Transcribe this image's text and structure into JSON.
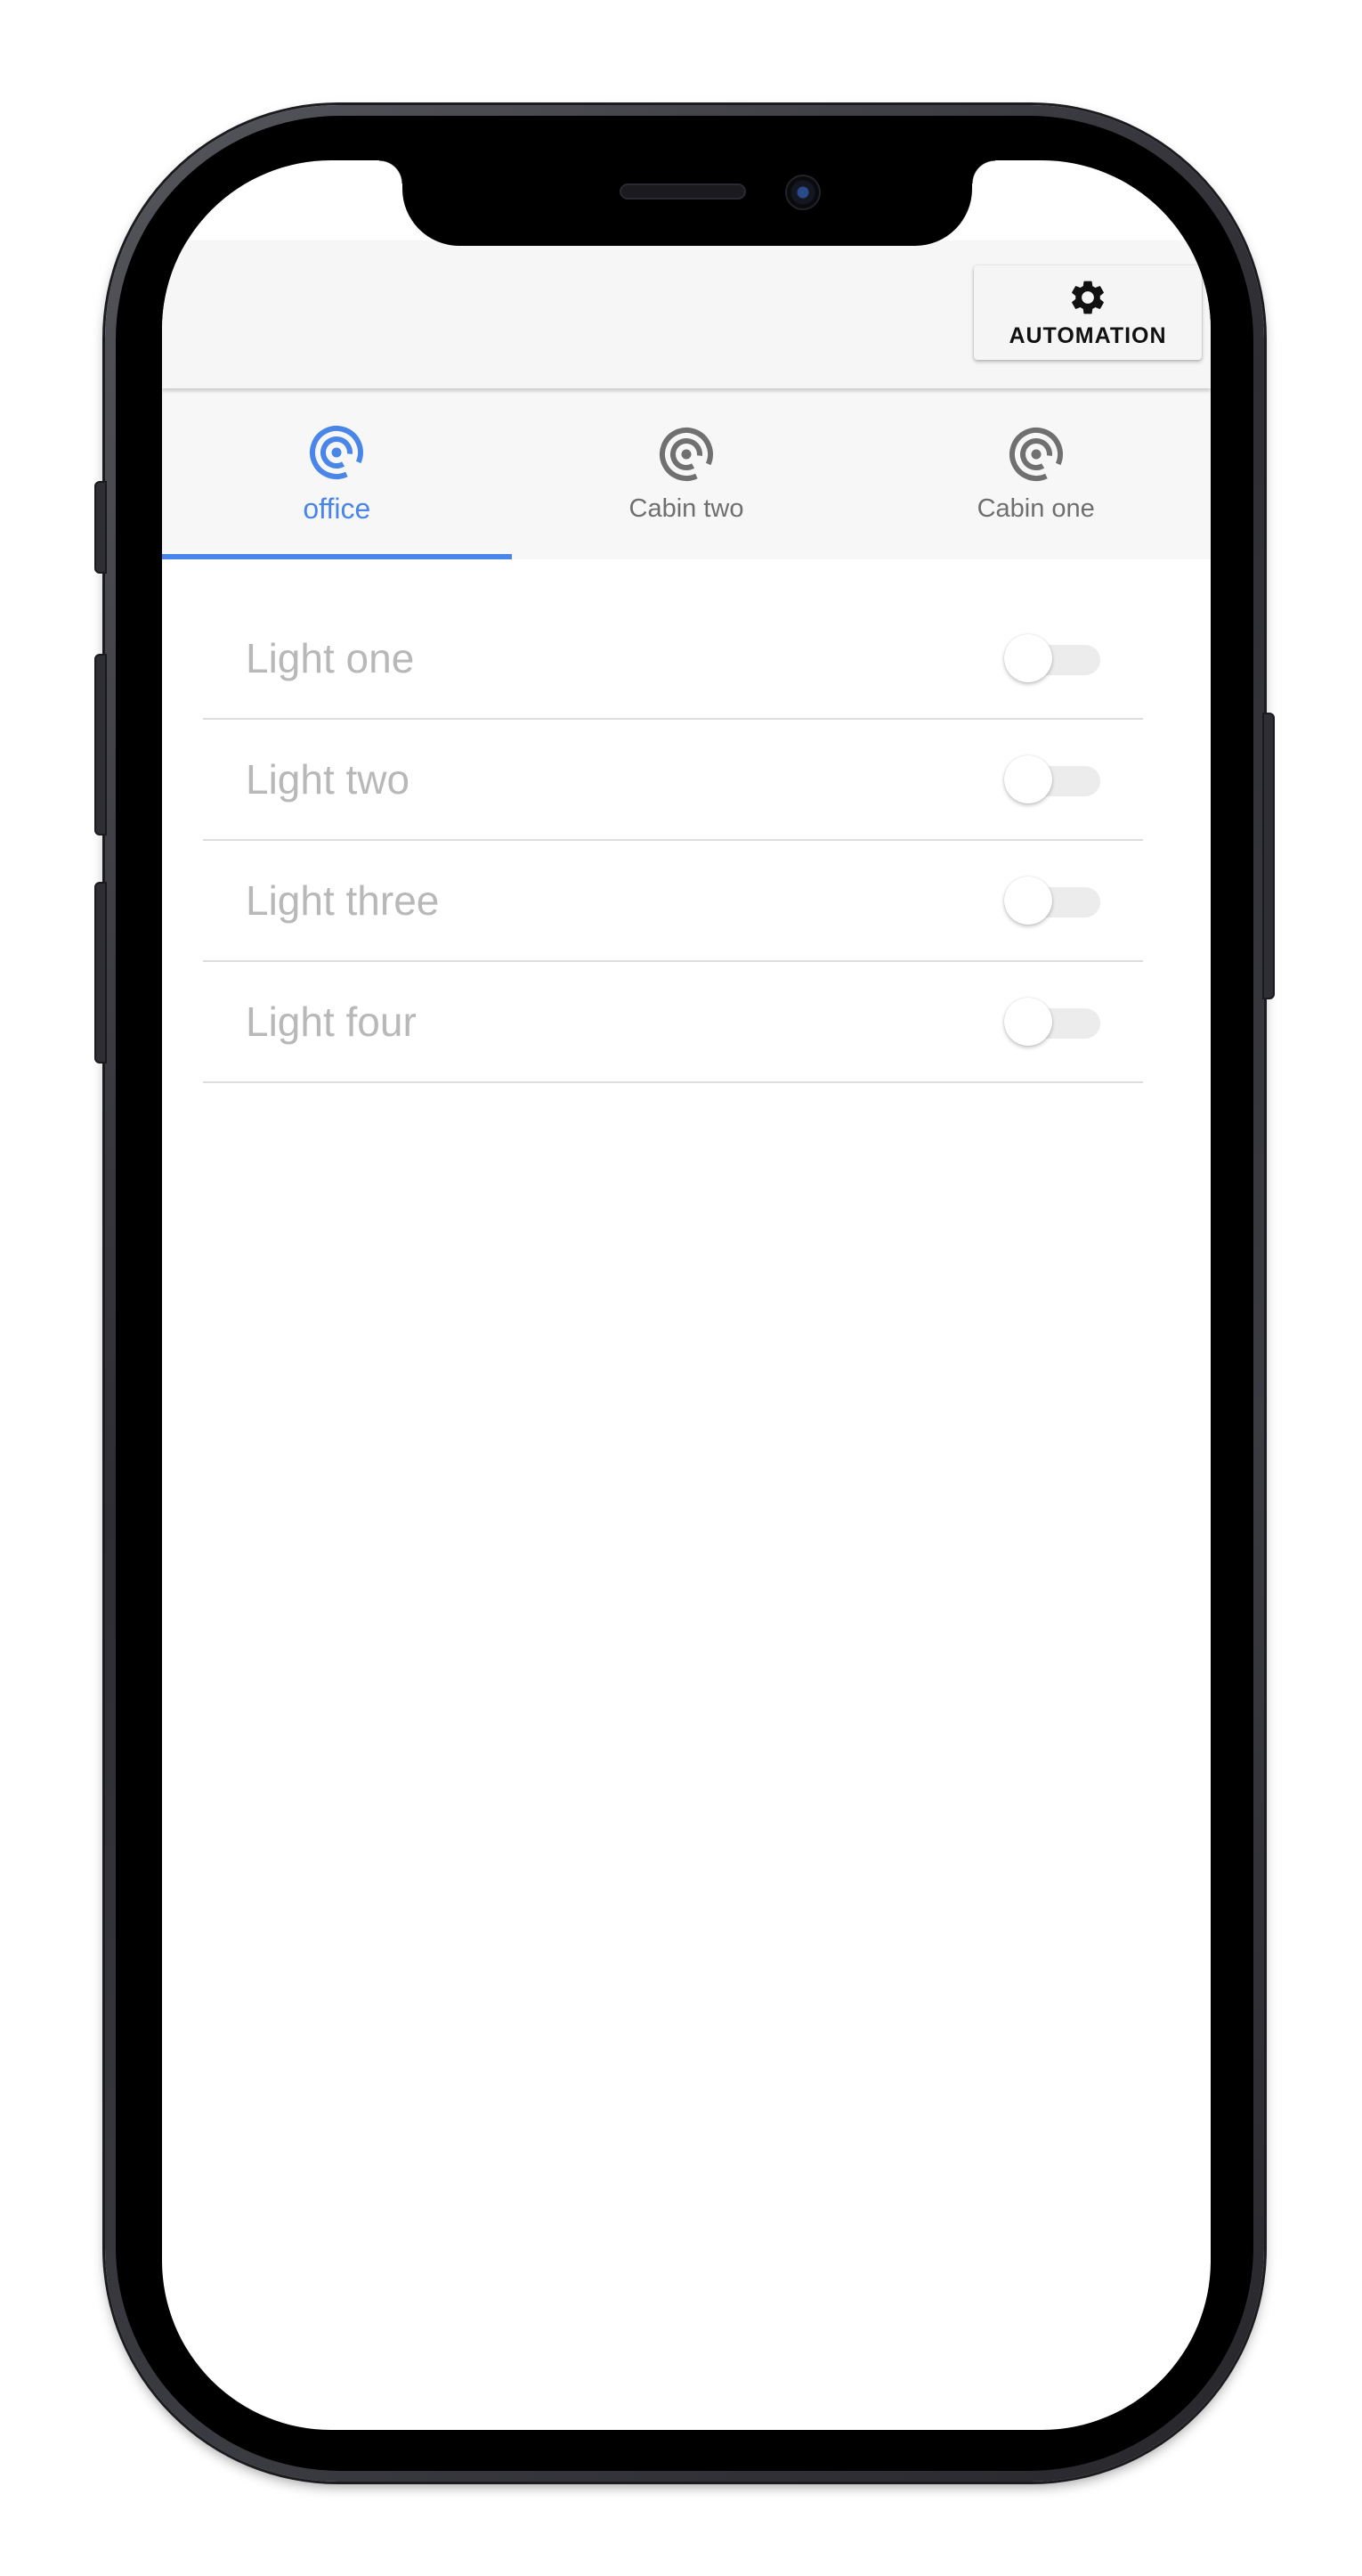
{
  "app": {
    "automation_label": "AUTOMATION",
    "automation_icon": "gear-icon"
  },
  "tabs": [
    {
      "label": "office",
      "icon": "broadcast-icon",
      "active": true
    },
    {
      "label": "Cabin two",
      "icon": "broadcast-icon",
      "active": false
    },
    {
      "label": "Cabin one",
      "icon": "broadcast-icon",
      "active": false
    }
  ],
  "lights": [
    {
      "name": "Light one",
      "on": false
    },
    {
      "name": "Light two",
      "on": false
    },
    {
      "name": "Light three",
      "on": false
    },
    {
      "name": "Light four",
      "on": false
    }
  ],
  "colors": {
    "accent": "#4a86e8",
    "inactive_icon": "#707070",
    "light_name_text": "#b8b8b8",
    "appbar_bg": "#f6f6f6"
  }
}
